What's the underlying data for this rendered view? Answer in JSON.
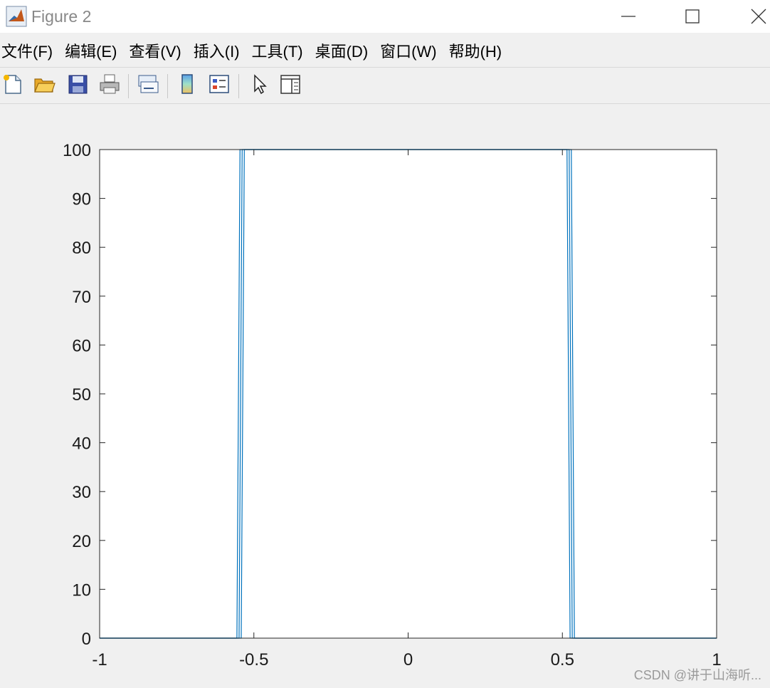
{
  "window": {
    "title": "Figure 2",
    "icon": "matlab-icon",
    "controls": [
      "minimize-icon",
      "maximize-icon",
      "close-icon"
    ]
  },
  "menu": {
    "items": [
      {
        "label": "文件(F)"
      },
      {
        "label": "编辑(E)"
      },
      {
        "label": "查看(V)"
      },
      {
        "label": "插入(I)"
      },
      {
        "label": "工具(T)"
      },
      {
        "label": "桌面(D)"
      },
      {
        "label": "窗口(W)"
      },
      {
        "label": "帮助(H)"
      }
    ]
  },
  "toolbar": {
    "icons": [
      "new-figure-icon",
      "open-file-icon",
      "save-icon",
      "print-icon",
      "link-plot-icon",
      "colorbar-icon",
      "legend-icon",
      "select-pointer-icon",
      "property-editor-icon"
    ]
  },
  "colors": {
    "line": "#0072bd",
    "axes": "#262626",
    "figure_bg": "#f0f0f0"
  },
  "chart_data": {
    "type": "line",
    "xlim": [
      -1,
      1
    ],
    "ylim": [
      0,
      100
    ],
    "xticks": [
      -1,
      -0.5,
      0,
      0.5,
      1
    ],
    "xtick_labels": [
      "-1",
      "-0.5",
      "0",
      "0.5",
      "1"
    ],
    "yticks": [
      0,
      10,
      20,
      30,
      40,
      50,
      60,
      70,
      80,
      90,
      100
    ],
    "ytick_labels": [
      "0",
      "10",
      "20",
      "30",
      "40",
      "50",
      "60",
      "70",
      "80",
      "90",
      "100"
    ],
    "grid": false,
    "box": true,
    "series": [
      {
        "x": [
          -1,
          -0.555,
          -0.545,
          0.515,
          0.525,
          1
        ],
        "y": [
          0,
          0,
          100,
          100,
          0,
          0
        ]
      },
      {
        "x": [
          -1,
          -0.548,
          -0.538,
          0.522,
          0.532,
          1
        ],
        "y": [
          0,
          0,
          100,
          100,
          0,
          0
        ]
      },
      {
        "x": [
          -1,
          -0.541,
          -0.531,
          0.529,
          0.539,
          1
        ],
        "y": [
          0,
          0,
          100,
          100,
          0,
          0
        ]
      }
    ]
  },
  "watermark": "CSDN @讲于山海听..."
}
